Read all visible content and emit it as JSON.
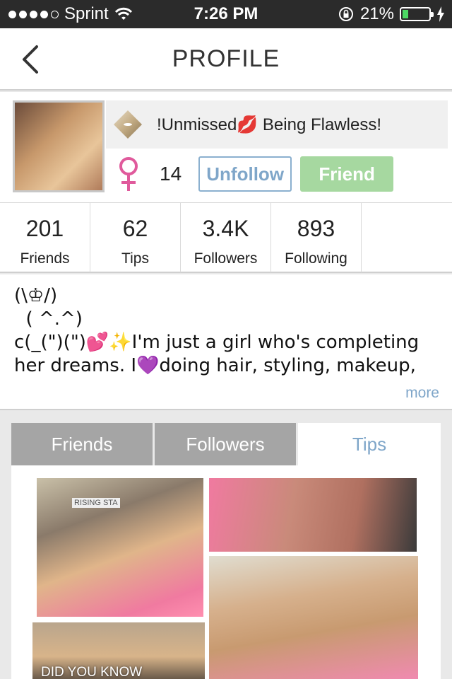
{
  "status_bar": {
    "carrier": "Sprint",
    "time": "7:26 PM",
    "battery_percent": "21%",
    "battery_level": 0.21
  },
  "nav": {
    "title": "PROFILE"
  },
  "profile": {
    "display_name": "!Unmissed💋 Being Flawless!",
    "age": "14",
    "unfollow_label": "Unfollow",
    "friend_label": "Friend"
  },
  "stats": [
    {
      "value": "201",
      "label": "Friends"
    },
    {
      "value": "62",
      "label": "Tips"
    },
    {
      "value": "3.4K",
      "label": "Followers"
    },
    {
      "value": "893",
      "label": "Following"
    }
  ],
  "bio": {
    "text": "(\\♔/)\n  ( ^.^)\nc(_(\")(\")💕✨I'm just a girl who's completing\nher dreams. I💜doing hair, styling, makeup,",
    "more_label": "more"
  },
  "tabs": [
    {
      "label": "Friends"
    },
    {
      "label": "Followers"
    },
    {
      "label": "Tips"
    }
  ],
  "tips": {
    "caption": "DID YOU KNOW",
    "sign_text": "RISING STA"
  },
  "colors": {
    "accent_blue": "#7fa6c9",
    "friend_green": "#a6d8a0",
    "gender_pink": "#e05a9c"
  }
}
